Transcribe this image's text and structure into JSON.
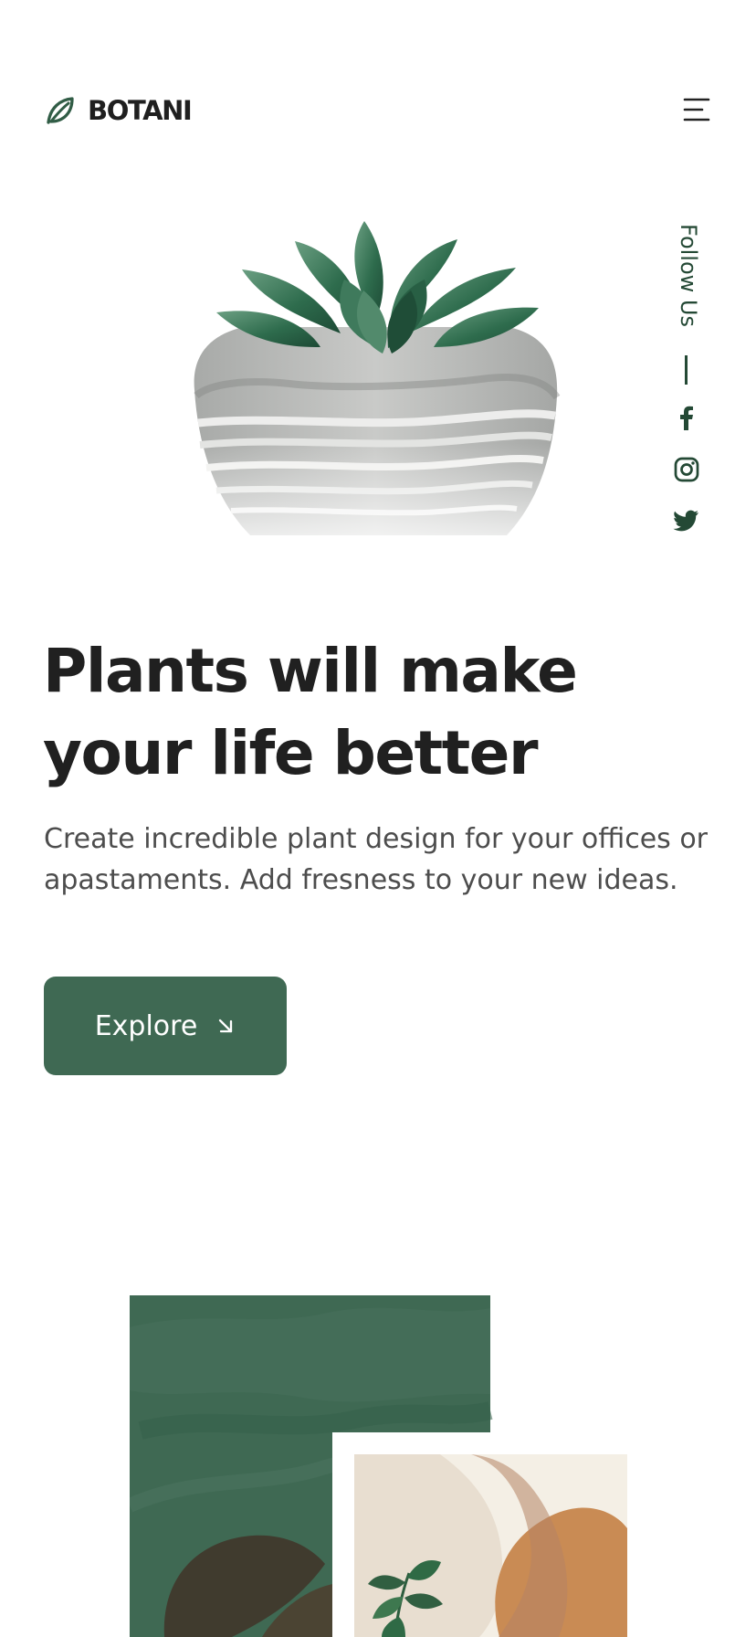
{
  "header": {
    "brand": {
      "name": "BOTANI",
      "icon": "leaf-icon"
    },
    "menu": {
      "icon": "menu-icon"
    }
  },
  "hero": {
    "title": "Plants will make your life better",
    "description": "Create incredible plant design for your offices or apastaments. Add fresness to your new ideas.",
    "button": {
      "label": "Explore",
      "icon": "arrow-down-right-icon"
    },
    "image": {
      "subject": "succulent-in-concrete-pot"
    }
  },
  "social": {
    "label": "Follow Us",
    "icons": [
      "facebook-icon",
      "instagram-icon",
      "twitter-icon"
    ]
  },
  "gallery": {
    "images": [
      "plant-care-image",
      "seedling-image"
    ]
  },
  "colors": {
    "brand_green": "#3f6953",
    "dark_green": "#244935",
    "text_dark": "#202020",
    "text_muted": "#4d4d4d",
    "background": "#ffffff"
  }
}
